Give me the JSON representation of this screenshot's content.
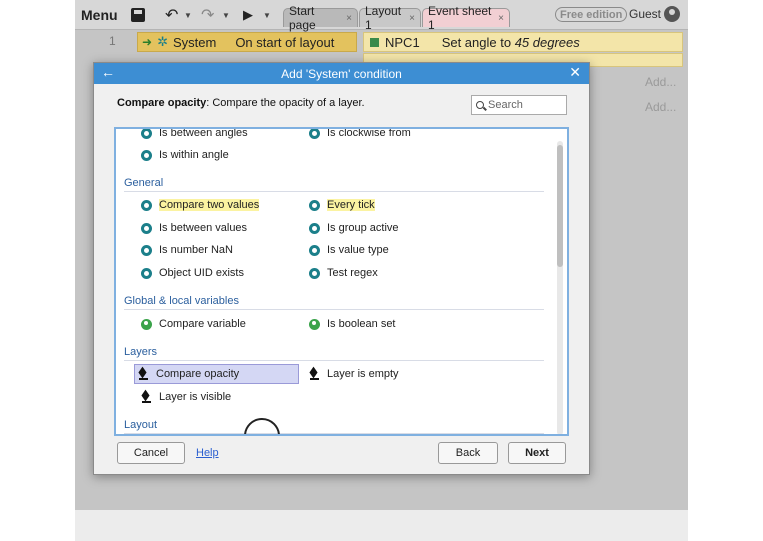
{
  "toolbar": {
    "menu_label": "Menu",
    "tabs": [
      {
        "label": "Start page"
      },
      {
        "label": "Layout 1"
      },
      {
        "label": "Event sheet 1"
      }
    ],
    "tab_close_glyph": "×",
    "edition_label": "Free edition",
    "user_label": "Guest"
  },
  "event_sheet": {
    "event_number": "1",
    "condition_object": "System",
    "condition_text": "On start of layout",
    "action_object": "NPC1",
    "action_text_prefix": "Set angle to ",
    "action_value": "45 degrees",
    "add_label_1": "Add...",
    "add_label_2": "Add..."
  },
  "dialog": {
    "title": "Add 'System' condition",
    "description_bold": "Compare opacity",
    "description_rest": ": Compare the opacity of a layer.",
    "search_placeholder": "Search",
    "list": {
      "top_items": [
        {
          "label": "Is between angles",
          "icon": "gear-icon"
        },
        {
          "label": "Is clockwise from",
          "icon": "gear-icon"
        },
        {
          "label": "Is within angle",
          "icon": "gear-icon"
        }
      ],
      "sections": [
        {
          "title": "General",
          "items": [
            {
              "label": "Compare two values",
              "icon": "gear-icon"
            },
            {
              "label": "Every tick",
              "icon": "gear-icon"
            },
            {
              "label": "Is between values",
              "icon": "gear-icon"
            },
            {
              "label": "Is group active",
              "icon": "gear-icon"
            },
            {
              "label": "Is number NaN",
              "icon": "gear-icon"
            },
            {
              "label": "Is value type",
              "icon": "gear-icon"
            },
            {
              "label": "Object UID exists",
              "icon": "gear-icon"
            },
            {
              "label": "Test regex",
              "icon": "gear-icon"
            }
          ]
        },
        {
          "title": "Global & local variables",
          "items": [
            {
              "label": "Compare variable",
              "icon": "globe-icon"
            },
            {
              "label": "Is boolean set",
              "icon": "globe-icon"
            }
          ]
        },
        {
          "title": "Layers",
          "items": [
            {
              "label": "Compare opacity",
              "icon": "layers-icon",
              "selected": true
            },
            {
              "label": "Layer is empty",
              "icon": "layers-icon"
            },
            {
              "label": "Layer is visible",
              "icon": "layers-icon"
            }
          ]
        },
        {
          "title": "Layout",
          "items": []
        }
      ]
    },
    "buttons": {
      "cancel": "Cancel",
      "help": "Help",
      "back": "Back",
      "next": "Next"
    }
  },
  "colors": {
    "titlebar": "#3d8ed3",
    "section_title": "#2b5f9e",
    "highlight": "#fbf3a1",
    "selection": "#d4d7f4",
    "condition_bg": "#e3c25e",
    "action_bg": "#f3e5a9",
    "event_tab": "#f2cfd3"
  }
}
